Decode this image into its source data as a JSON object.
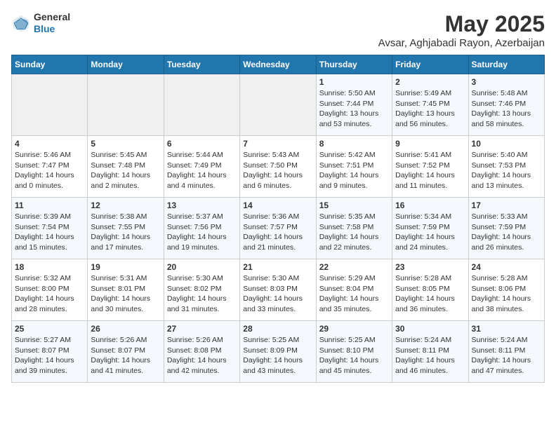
{
  "logo": {
    "general": "General",
    "blue": "Blue"
  },
  "title": "May 2025",
  "subtitle": "Avsar, Aghjabadi Rayon, Azerbaijan",
  "headers": [
    "Sunday",
    "Monday",
    "Tuesday",
    "Wednesday",
    "Thursday",
    "Friday",
    "Saturday"
  ],
  "weeks": [
    [
      {
        "day": "",
        "info": ""
      },
      {
        "day": "",
        "info": ""
      },
      {
        "day": "",
        "info": ""
      },
      {
        "day": "",
        "info": ""
      },
      {
        "day": "1",
        "info": "Sunrise: 5:50 AM\nSunset: 7:44 PM\nDaylight: 13 hours\nand 53 minutes."
      },
      {
        "day": "2",
        "info": "Sunrise: 5:49 AM\nSunset: 7:45 PM\nDaylight: 13 hours\nand 56 minutes."
      },
      {
        "day": "3",
        "info": "Sunrise: 5:48 AM\nSunset: 7:46 PM\nDaylight: 13 hours\nand 58 minutes."
      }
    ],
    [
      {
        "day": "4",
        "info": "Sunrise: 5:46 AM\nSunset: 7:47 PM\nDaylight: 14 hours\nand 0 minutes."
      },
      {
        "day": "5",
        "info": "Sunrise: 5:45 AM\nSunset: 7:48 PM\nDaylight: 14 hours\nand 2 minutes."
      },
      {
        "day": "6",
        "info": "Sunrise: 5:44 AM\nSunset: 7:49 PM\nDaylight: 14 hours\nand 4 minutes."
      },
      {
        "day": "7",
        "info": "Sunrise: 5:43 AM\nSunset: 7:50 PM\nDaylight: 14 hours\nand 6 minutes."
      },
      {
        "day": "8",
        "info": "Sunrise: 5:42 AM\nSunset: 7:51 PM\nDaylight: 14 hours\nand 9 minutes."
      },
      {
        "day": "9",
        "info": "Sunrise: 5:41 AM\nSunset: 7:52 PM\nDaylight: 14 hours\nand 11 minutes."
      },
      {
        "day": "10",
        "info": "Sunrise: 5:40 AM\nSunset: 7:53 PM\nDaylight: 14 hours\nand 13 minutes."
      }
    ],
    [
      {
        "day": "11",
        "info": "Sunrise: 5:39 AM\nSunset: 7:54 PM\nDaylight: 14 hours\nand 15 minutes."
      },
      {
        "day": "12",
        "info": "Sunrise: 5:38 AM\nSunset: 7:55 PM\nDaylight: 14 hours\nand 17 minutes."
      },
      {
        "day": "13",
        "info": "Sunrise: 5:37 AM\nSunset: 7:56 PM\nDaylight: 14 hours\nand 19 minutes."
      },
      {
        "day": "14",
        "info": "Sunrise: 5:36 AM\nSunset: 7:57 PM\nDaylight: 14 hours\nand 21 minutes."
      },
      {
        "day": "15",
        "info": "Sunrise: 5:35 AM\nSunset: 7:58 PM\nDaylight: 14 hours\nand 22 minutes."
      },
      {
        "day": "16",
        "info": "Sunrise: 5:34 AM\nSunset: 7:59 PM\nDaylight: 14 hours\nand 24 minutes."
      },
      {
        "day": "17",
        "info": "Sunrise: 5:33 AM\nSunset: 7:59 PM\nDaylight: 14 hours\nand 26 minutes."
      }
    ],
    [
      {
        "day": "18",
        "info": "Sunrise: 5:32 AM\nSunset: 8:00 PM\nDaylight: 14 hours\nand 28 minutes."
      },
      {
        "day": "19",
        "info": "Sunrise: 5:31 AM\nSunset: 8:01 PM\nDaylight: 14 hours\nand 30 minutes."
      },
      {
        "day": "20",
        "info": "Sunrise: 5:30 AM\nSunset: 8:02 PM\nDaylight: 14 hours\nand 31 minutes."
      },
      {
        "day": "21",
        "info": "Sunrise: 5:30 AM\nSunset: 8:03 PM\nDaylight: 14 hours\nand 33 minutes."
      },
      {
        "day": "22",
        "info": "Sunrise: 5:29 AM\nSunset: 8:04 PM\nDaylight: 14 hours\nand 35 minutes."
      },
      {
        "day": "23",
        "info": "Sunrise: 5:28 AM\nSunset: 8:05 PM\nDaylight: 14 hours\nand 36 minutes."
      },
      {
        "day": "24",
        "info": "Sunrise: 5:28 AM\nSunset: 8:06 PM\nDaylight: 14 hours\nand 38 minutes."
      }
    ],
    [
      {
        "day": "25",
        "info": "Sunrise: 5:27 AM\nSunset: 8:07 PM\nDaylight: 14 hours\nand 39 minutes."
      },
      {
        "day": "26",
        "info": "Sunrise: 5:26 AM\nSunset: 8:07 PM\nDaylight: 14 hours\nand 41 minutes."
      },
      {
        "day": "27",
        "info": "Sunrise: 5:26 AM\nSunset: 8:08 PM\nDaylight: 14 hours\nand 42 minutes."
      },
      {
        "day": "28",
        "info": "Sunrise: 5:25 AM\nSunset: 8:09 PM\nDaylight: 14 hours\nand 43 minutes."
      },
      {
        "day": "29",
        "info": "Sunrise: 5:25 AM\nSunset: 8:10 PM\nDaylight: 14 hours\nand 45 minutes."
      },
      {
        "day": "30",
        "info": "Sunrise: 5:24 AM\nSunset: 8:11 PM\nDaylight: 14 hours\nand 46 minutes."
      },
      {
        "day": "31",
        "info": "Sunrise: 5:24 AM\nSunset: 8:11 PM\nDaylight: 14 hours\nand 47 minutes."
      }
    ]
  ]
}
